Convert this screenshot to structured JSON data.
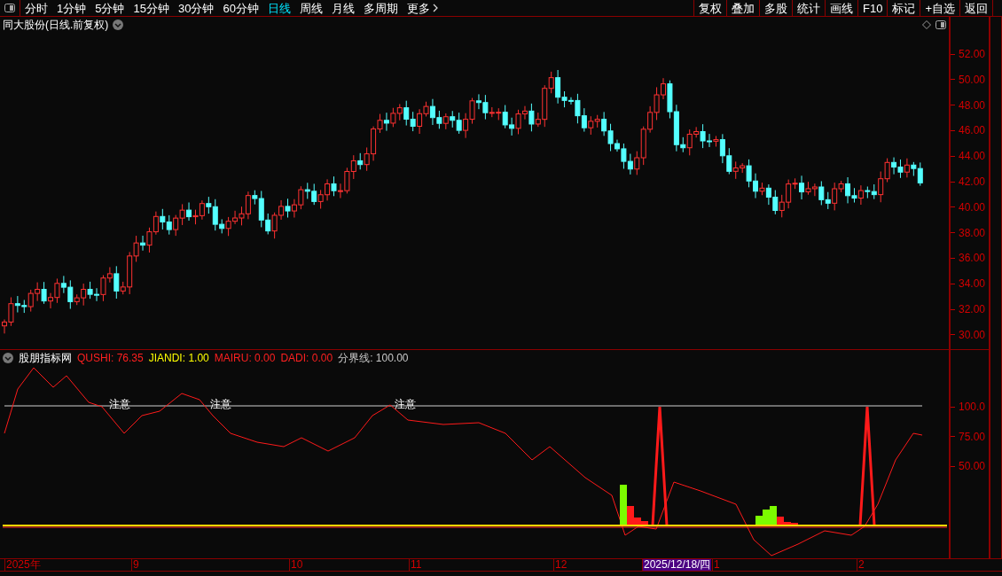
{
  "toolbar": {
    "periods": [
      {
        "label": "分时",
        "kind": "period",
        "selected": false
      },
      {
        "label": "1分钟",
        "kind": "period",
        "selected": false
      },
      {
        "label": "5分钟",
        "kind": "period",
        "selected": false
      },
      {
        "label": "15分钟",
        "kind": "period",
        "selected": false
      },
      {
        "label": "30分钟",
        "kind": "period",
        "selected": false
      },
      {
        "label": "60分钟",
        "kind": "period",
        "selected": false
      },
      {
        "label": "日线",
        "kind": "period",
        "selected": true
      },
      {
        "label": "周线",
        "kind": "period",
        "selected": false
      },
      {
        "label": "月线",
        "kind": "period",
        "selected": false
      },
      {
        "label": "多周期",
        "kind": "period",
        "selected": false
      },
      {
        "label": "更多",
        "kind": "menu",
        "selected": false
      }
    ],
    "actions": [
      "复权",
      "叠加",
      "多股",
      "统计",
      "画线",
      "F10",
      "标记",
      "+自选",
      "返回"
    ]
  },
  "main_chart": {
    "title": "同大股份(日线.前复权)",
    "price_ticks": [
      "52.00",
      "50.00",
      "48.00",
      "46.00",
      "44.00",
      "42.00",
      "40.00",
      "38.00",
      "36.00",
      "34.00",
      "32.00",
      "30.00"
    ]
  },
  "indicator": {
    "name": "股朋指标网",
    "readouts": [
      {
        "label": "QUSHI: 76.35",
        "color": "#ff2020"
      },
      {
        "label": "JIANDI: 1.00",
        "color": "#ffff00"
      },
      {
        "label": "MAIRU: 0.00",
        "color": "#ff2020"
      },
      {
        "label": "DADI: 0.00",
        "color": "#ff2020"
      },
      {
        "label": "分界线: 100.00",
        "color": "#c8c8c8"
      }
    ],
    "markers": [
      "注意",
      "注意",
      "注意"
    ],
    "ticks": [
      "100.0",
      "75.00",
      "50.00"
    ]
  },
  "date_axis": {
    "labels": [
      {
        "label": "2025年",
        "selected": false
      },
      {
        "label": "9",
        "selected": false
      },
      {
        "label": "10",
        "selected": false
      },
      {
        "label": "11",
        "selected": false
      },
      {
        "label": "12",
        "selected": false
      },
      {
        "label": "2025/12/18/四",
        "selected": true
      },
      {
        "label": "1",
        "selected": false
      },
      {
        "label": "2",
        "selected": false
      }
    ]
  }
}
